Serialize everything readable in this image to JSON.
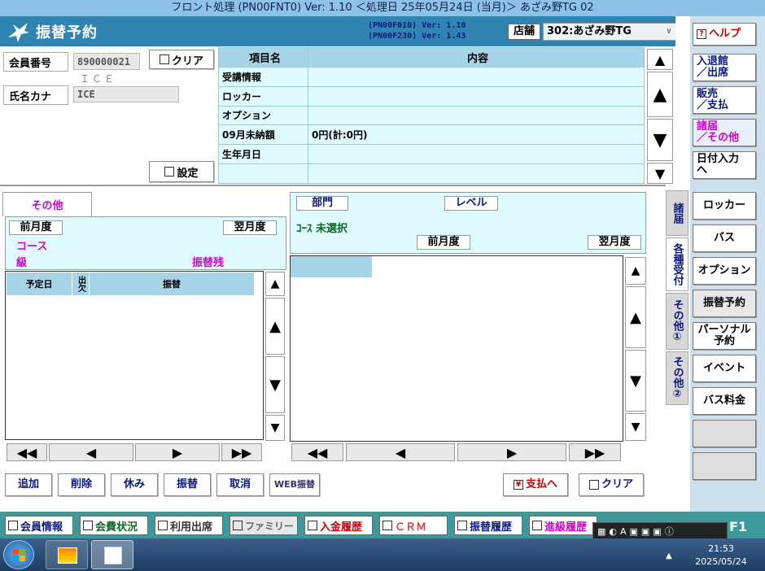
{
  "titlebar": {
    "text": "フロント処理 (PN00FNT0) Ver: 1.10 ＜処理日 25年05月24日 (当月)＞ あざみ野TG 02"
  },
  "header": {
    "title": "振替予約",
    "ver1": "(PN00F010)  Ver: 1.10",
    "ver2": "(PN00F230)  Ver: 1.43",
    "store_label": "店舗",
    "store_value": "302:あざみ野TG"
  },
  "member": {
    "number_label": "会員番号",
    "number_value": "890000021",
    "clear_label": "クリア",
    "ice_text": "ＩＣＥ",
    "kana_label": "氏名カナ",
    "kana_value": "ICE",
    "setting_label": "設定"
  },
  "info_table": {
    "col_item": "項目名",
    "col_content": "内容",
    "rows": [
      {
        "item": "受講情報",
        "content": ""
      },
      {
        "item": "ロッカー",
        "content": ""
      },
      {
        "item": "オプション",
        "content": ""
      },
      {
        "item": "09月未納額",
        "content": "0円(計:0円)"
      },
      {
        "item": "生年月日",
        "content": ""
      },
      {
        "item": "",
        "content": ""
      }
    ]
  },
  "right_menu": {
    "help": "ヘルプ",
    "entry": "入退館\n／出席",
    "sales": "販売\n／支払",
    "misc": "諸届\n／その他",
    "date_input": "日付入力\nへ",
    "locker": "ロッカー",
    "bus": "バス",
    "option": "オプション",
    "transfer": "振替予約",
    "personal": "パーソナル予約",
    "event": "イベント",
    "bus_fee": "バス料金"
  },
  "vtabs": {
    "shoto": "諸届",
    "kakushu": "各種受付",
    "other1": "その他①",
    "other2": "その他②"
  },
  "left_panel": {
    "tab": "その他",
    "prev_month": "前月度",
    "next_month": "翌月度",
    "course_label": "コース",
    "grade_label": "級",
    "transfer_remaining": "振替残",
    "col_date": "予定日",
    "col_attend": "出欠",
    "col_transfer": "振替"
  },
  "right_area": {
    "dept_btn": "部門",
    "level_btn": "レベル",
    "course_text": "ｺｰｽ 未選択",
    "prev_month": "前月度",
    "next_month": "翌月度"
  },
  "actions": {
    "add": "追加",
    "delete": "削除",
    "rest": "休み",
    "transfer": "振替",
    "cancel": "取消",
    "web_transfer": "WEB振替",
    "pay": "支払へ",
    "clear": "クリア"
  },
  "statusbar": {
    "member_info": "会員情報",
    "fee_status": "会費状況",
    "usage": "利用出席",
    "family": "ファミリー",
    "payment_history": "入金履歴",
    "crm": "ＣＲＭ",
    "transfer_history": "振替履歴",
    "grade_history": "進級履歴",
    "f1": "F1"
  },
  "taskbar": {
    "time": "21:53",
    "date": "2025/05/24"
  }
}
